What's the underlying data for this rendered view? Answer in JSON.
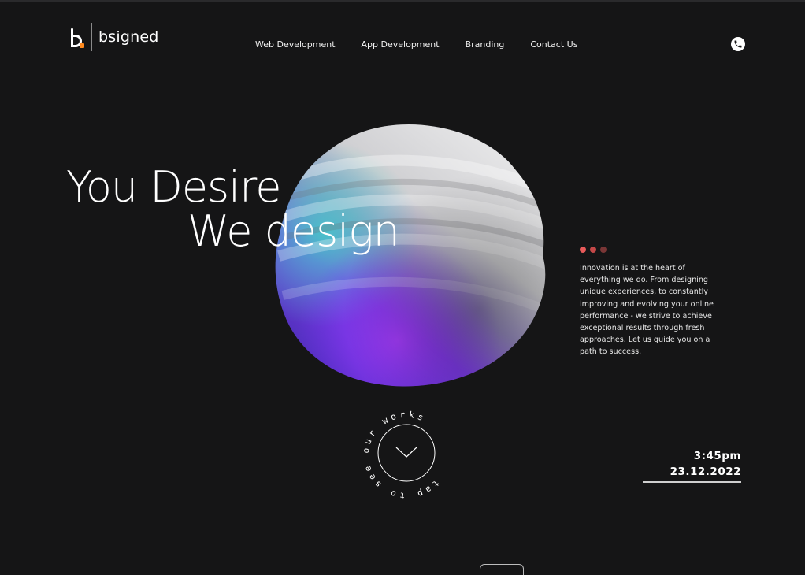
{
  "brand": {
    "name": "bsigned",
    "accent_color": "#ff8a1f"
  },
  "nav": {
    "items": [
      {
        "label": "Web Development",
        "active": true
      },
      {
        "label": "App Development",
        "active": false
      },
      {
        "label": "Branding",
        "active": false
      },
      {
        "label": "Contact Us",
        "active": false
      }
    ]
  },
  "header": {
    "phone_icon": "phone-icon"
  },
  "hero": {
    "line1": "You Desire",
    "line2": "We design"
  },
  "intro": {
    "dot_colors": [
      "#e85a5a",
      "#c44848",
      "#7a3636"
    ],
    "text": "Innovation is at the heart of everything we do. From designing unique experiences, to constantly improving and evolving your online performance - we strive to achieve exceptional results through fresh approaches. Let us guide you on a path to success."
  },
  "scroll_cta": {
    "text": "tap to see our works",
    "icon": "chevron-down-icon"
  },
  "clock": {
    "time": "3:45pm",
    "date": "23.12.2022"
  },
  "colors": {
    "background": "#151516",
    "text": "#ffffff"
  }
}
